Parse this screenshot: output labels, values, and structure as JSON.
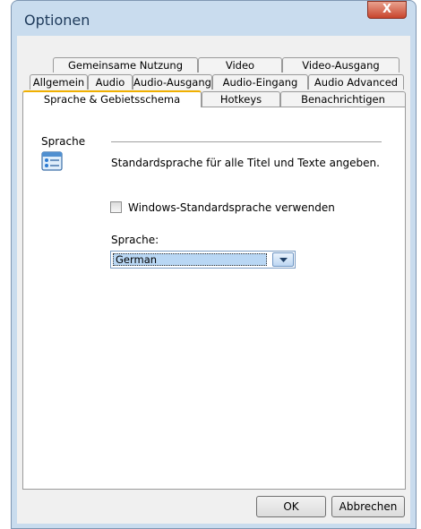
{
  "window": {
    "title": "Optionen",
    "close_label": "X"
  },
  "tabs": {
    "row1": [
      "Gemeinsame Nutzung",
      "Video",
      "Video-Ausgang"
    ],
    "row2": [
      "Allgemein",
      "Audio",
      "Audio-Ausgang",
      "Audio-Eingang",
      "Audio Advanced"
    ],
    "row3": [
      "Sprache & Gebietsschema",
      "Hotkeys",
      "Benachrichtigen"
    ],
    "active": "Sprache & Gebietsschema"
  },
  "section": {
    "heading": "Sprache",
    "description": "Standardsprache für alle Titel und Texte angeben.",
    "icon": "language-settings-icon"
  },
  "checkbox": {
    "label": "Windows-Standardsprache verwenden",
    "checked": false
  },
  "language_select": {
    "label": "Sprache:",
    "value": "German"
  },
  "buttons": {
    "ok": "OK",
    "cancel": "Abbrechen"
  }
}
